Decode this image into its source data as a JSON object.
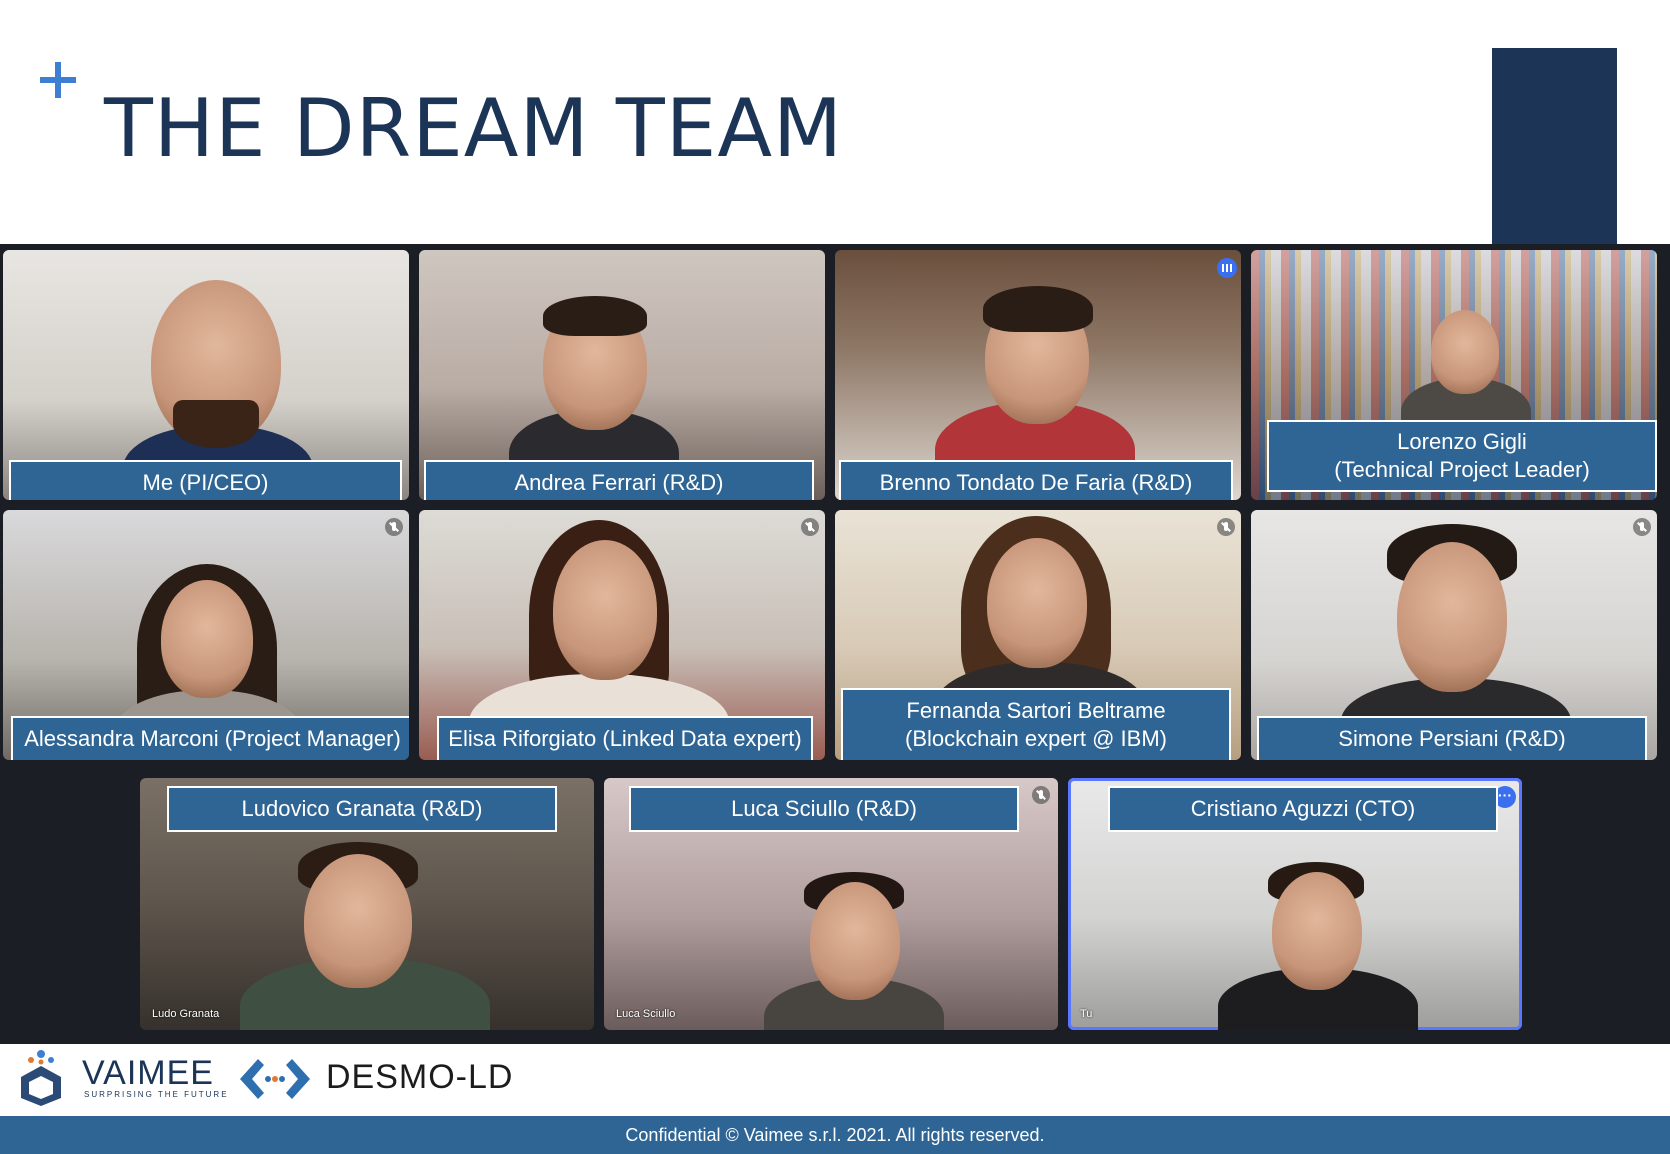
{
  "slide": {
    "title": "THE DREAM TEAM",
    "accent_color": "#3f7fd3",
    "title_color": "#1c3557",
    "label_color": "#2e6595"
  },
  "tiles": [
    {
      "label": "Me (PI/CEO)",
      "status_icon": "none"
    },
    {
      "label": "Andrea Ferrari (R&D)",
      "status_icon": "none"
    },
    {
      "label": "Brenno Tondato De Faria (R&D)",
      "status_icon": "speaking-icon"
    },
    {
      "label": "Lorenzo Gigli\n(Technical Project Leader)",
      "status_icon": "none"
    },
    {
      "label": "Alessandra Marconi (Project Manager)",
      "status_icon": "mic-off-icon"
    },
    {
      "label": "Elisa Riforgiato (Linked Data expert)",
      "status_icon": "mic-off-icon"
    },
    {
      "label": "Fernanda Sartori Beltrame\n(Blockchain expert @ IBM)",
      "status_icon": "mic-off-icon"
    },
    {
      "label": "Simone Persiani (R&D)",
      "status_icon": "mic-off-icon"
    },
    {
      "label": "Ludovico Granata (R&D)",
      "status_icon": "none",
      "tile_name": "Ludo Granata"
    },
    {
      "label": "Luca Sciullo (R&D)",
      "status_icon": "mic-off-icon",
      "tile_name": "Luca Sciullo"
    },
    {
      "label": "Cristiano Aguzzi (CTO)",
      "status_icon": "more-icon",
      "tile_name": "Tu"
    }
  ],
  "footer": {
    "vaimee_name": "VAIMEE",
    "vaimee_tagline": "SURPRISING THE FUTURE",
    "desmo_name": "DESMO-LD",
    "copyright": "Confidential © Vaimee s.r.l. 2021. All rights reserved."
  }
}
